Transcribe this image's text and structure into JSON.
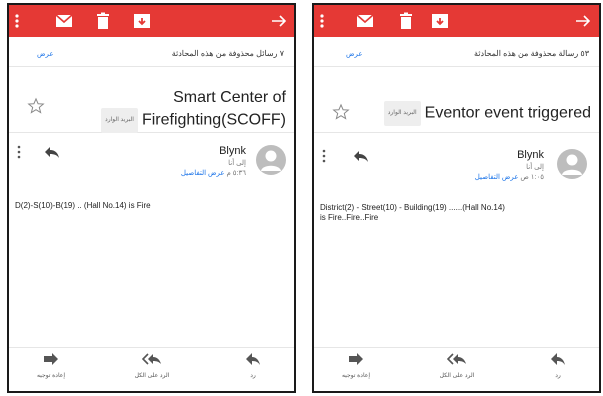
{
  "colors": {
    "appbar": "#e53935",
    "link": "#1a73e8",
    "avatar": "#bdbdbd"
  },
  "icons": [
    "more-vert-icon",
    "mail-icon",
    "delete-icon",
    "archive-icon",
    "arrow-forward-icon",
    "star-icon",
    "reply-icon",
    "forward-icon",
    "reply-all-icon",
    "person-icon"
  ],
  "left": {
    "hidden_messages": "٧ رسائل محذوفة من هذه المحادثة",
    "show_label": "عرض",
    "subject_line1": "Smart Center of",
    "subject_line2": "Firefighting(SCOFF)",
    "inbox_badge": "البريد الوارد",
    "sender_name": "Blynk",
    "to_me": "إلى أنا",
    "time": "٥:٣٦ م",
    "show_details": "عرض التفاصيل",
    "body": "D(2)-S(10)-B(19) .. (Hall No.14) is Fire",
    "actions": {
      "forward": "إعادة توجيه",
      "reply_all": "الرد على الكل",
      "reply": "رد"
    }
  },
  "right": {
    "hidden_messages": "٥٣ رسالة محذوفة من هذه المحادثة",
    "show_label": "عرض",
    "subject": "Eventor event triggered",
    "inbox_badge": "البريد الوارد",
    "sender_name": "Blynk",
    "to_me": "إلى أنا",
    "time": "١:٠٥ ص",
    "show_details": "عرض التفاصيل",
    "body_line1": "District(2) - Street(10) - Building(19) ......(Hall No.14)",
    "body_line2": "is Fire..Fire..Fire",
    "actions": {
      "forward": "إعادة توجيه",
      "reply_all": "الرد على الكل",
      "reply": "رد"
    }
  }
}
